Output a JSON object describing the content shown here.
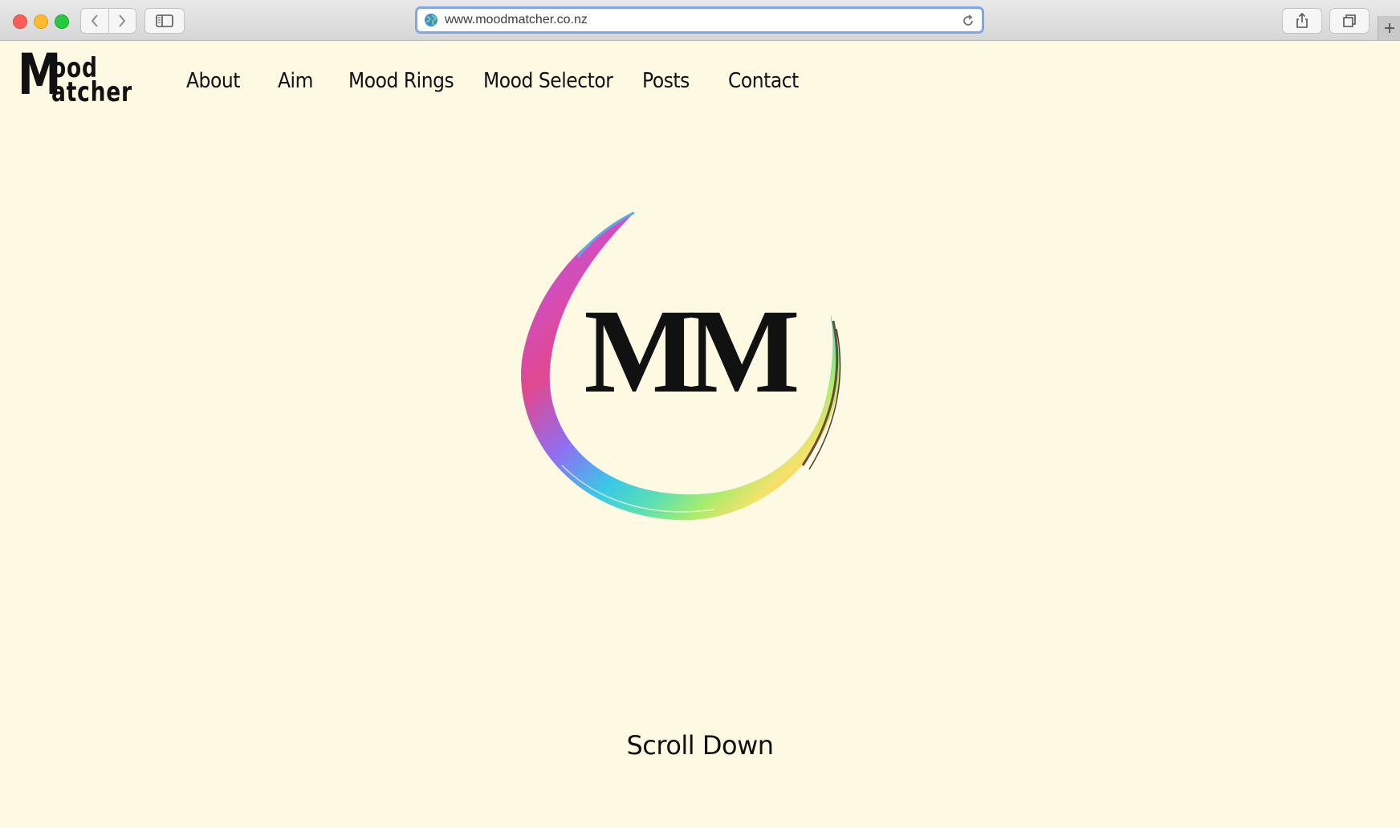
{
  "browser": {
    "url": "www.moodmatcher.co.nz",
    "icons": {
      "back": "chevron-left-icon",
      "forward": "chevron-right-icon",
      "sidebar": "sidebar-icon",
      "globe": "globe-icon",
      "reload": "reload-icon",
      "share": "share-icon",
      "tabs": "tabs-icon",
      "new_tab": "plus-icon"
    }
  },
  "site": {
    "logo": {
      "big_letter": "M",
      "line1": "ood",
      "line2": "atcher"
    },
    "nav": [
      {
        "label": "About"
      },
      {
        "label": "Aim"
      },
      {
        "label": "Mood Rings"
      },
      {
        "label": "Mood Selector"
      },
      {
        "label": "Posts"
      },
      {
        "label": "Contact"
      }
    ],
    "emblem_text": "MM",
    "scroll_label": "Scroll Down"
  },
  "colors": {
    "page_background": "#fdf9e3",
    "text": "#111111",
    "url_focus_ring": "#7fa6e6",
    "ring_gradient": [
      "#5aa9f0",
      "#d04fc4",
      "#e0488f",
      "#8f6ff2",
      "#38c9e6",
      "#5fe0b0",
      "#a6ec6d",
      "#f6e26b",
      "#f2a25e",
      "#8a5a45"
    ]
  }
}
